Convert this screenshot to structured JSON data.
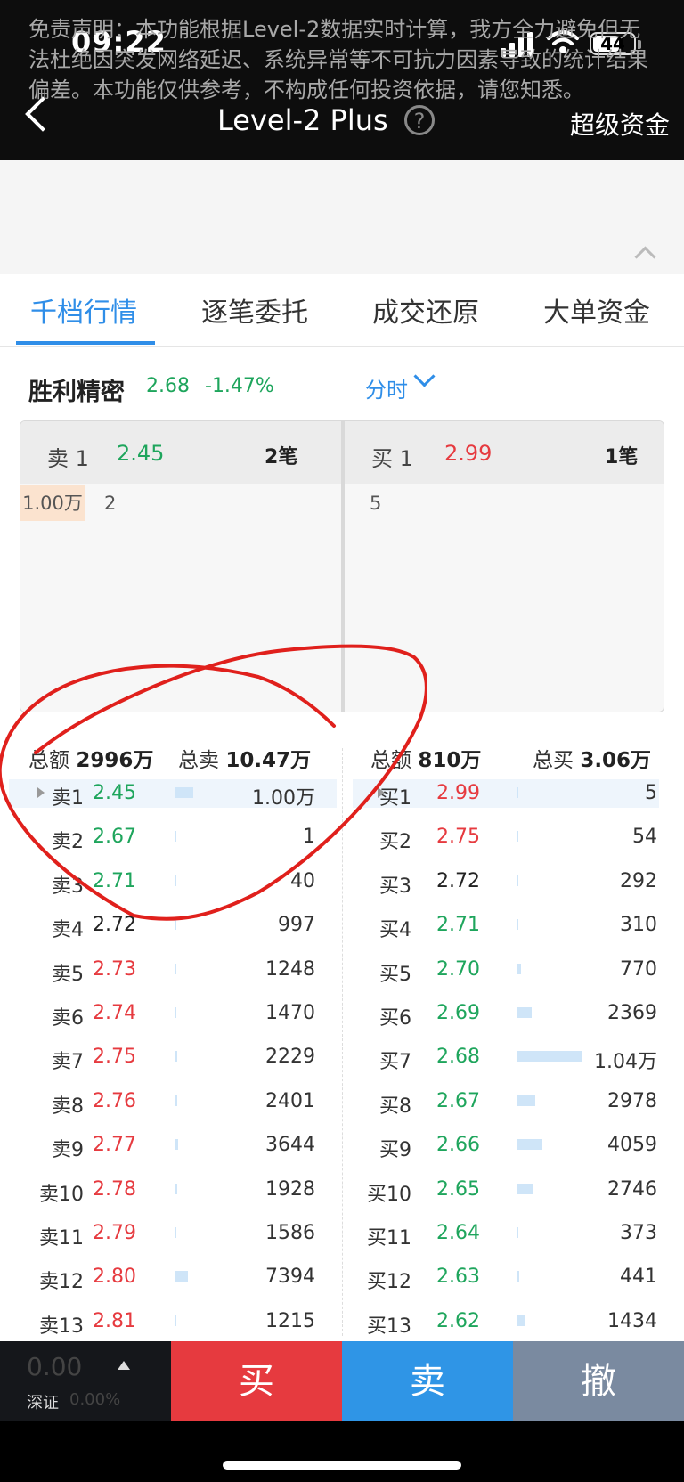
{
  "status_bar": {
    "time": "09:22",
    "battery": "44"
  },
  "nav": {
    "title": "Level-2 Plus",
    "help": "?",
    "right": "超级资金"
  },
  "disclaimer": "免责声明：本功能根据Level-2数据实时计算，我方全力避免但无法杜绝因突发网络延迟、系统异常等不可抗力因素导致的统计结果偏差。本功能仅供参考，不构成任何投资依据，请您知悉。",
  "tabs": [
    "千档行情",
    "逐笔委托",
    "成交还原",
    "大单资金"
  ],
  "stock": {
    "name": "胜利精密",
    "price": "2.68",
    "change": "-1.47%",
    "period": "分时"
  },
  "queue": {
    "sell": {
      "label": "卖 1",
      "price": "2.45",
      "count": "2笔",
      "items": [
        "1.00万",
        "2"
      ]
    },
    "buy": {
      "label": "买 1",
      "price": "2.99",
      "count": "1笔",
      "items": [
        "5"
      ]
    }
  },
  "totals": {
    "sell_amount_label": "总额",
    "sell_amount": "2996万",
    "sell_total_label": "总卖",
    "sell_total": "10.47万",
    "buy_amount_label": "总额",
    "buy_amount": "810万",
    "buy_total_label": "总买",
    "buy_total": "3.06万"
  },
  "colors": {
    "up": "#e63a3f",
    "down": "#1ea55c",
    "flat": "#222222",
    "accent": "#2f8ee8",
    "buy_btn": "#e63a3f",
    "sell_btn": "#2f95e6",
    "cancel_btn": "#7a8aa0"
  },
  "sell_levels": [
    {
      "label": "卖1",
      "price": "2.45",
      "color": "green",
      "vol": "1.00万",
      "bar": 0.28
    },
    {
      "label": "卖2",
      "price": "2.67",
      "color": "green",
      "vol": "1",
      "bar": 0
    },
    {
      "label": "卖3",
      "price": "2.71",
      "color": "green",
      "vol": "40",
      "bar": 0
    },
    {
      "label": "卖4",
      "price": "2.72",
      "color": "dark",
      "vol": "997",
      "bar": 0.02
    },
    {
      "label": "卖5",
      "price": "2.73",
      "color": "red",
      "vol": "1248",
      "bar": 0.03
    },
    {
      "label": "卖6",
      "price": "2.74",
      "color": "red",
      "vol": "1470",
      "bar": 0.03
    },
    {
      "label": "卖7",
      "price": "2.75",
      "color": "red",
      "vol": "2229",
      "bar": 0.04
    },
    {
      "label": "卖8",
      "price": "2.76",
      "color": "red",
      "vol": "2401",
      "bar": 0.04
    },
    {
      "label": "卖9",
      "price": "2.77",
      "color": "red",
      "vol": "3644",
      "bar": 0.05
    },
    {
      "label": "卖10",
      "price": "2.78",
      "color": "red",
      "vol": "1928",
      "bar": 0.04
    },
    {
      "label": "卖11",
      "price": "2.79",
      "color": "red",
      "vol": "1586",
      "bar": 0.03
    },
    {
      "label": "卖12",
      "price": "2.80",
      "color": "red",
      "vol": "7394",
      "bar": 0.2
    },
    {
      "label": "卖13",
      "price": "2.81",
      "color": "red",
      "vol": "1215",
      "bar": 0.03
    }
  ],
  "buy_levels": [
    {
      "label": "买1",
      "price": "2.99",
      "color": "red",
      "vol": "5",
      "bar": 0
    },
    {
      "label": "买2",
      "price": "2.75",
      "color": "red",
      "vol": "54",
      "bar": 0.02
    },
    {
      "label": "买3",
      "price": "2.72",
      "color": "dark",
      "vol": "292",
      "bar": 0.02
    },
    {
      "label": "买4",
      "price": "2.71",
      "color": "green",
      "vol": "310",
      "bar": 0.02
    },
    {
      "label": "买5",
      "price": "2.70",
      "color": "green",
      "vol": "770",
      "bar": 0.07
    },
    {
      "label": "买6",
      "price": "2.69",
      "color": "green",
      "vol": "2369",
      "bar": 0.23
    },
    {
      "label": "买7",
      "price": "2.68",
      "color": "green",
      "vol": "1.04万",
      "bar": 1.0
    },
    {
      "label": "买8",
      "price": "2.67",
      "color": "green",
      "vol": "2978",
      "bar": 0.29
    },
    {
      "label": "买9",
      "price": "2.66",
      "color": "green",
      "vol": "4059",
      "bar": 0.39
    },
    {
      "label": "买10",
      "price": "2.65",
      "color": "green",
      "vol": "2746",
      "bar": 0.26
    },
    {
      "label": "买11",
      "price": "2.64",
      "color": "green",
      "vol": "373",
      "bar": 0.03
    },
    {
      "label": "买12",
      "price": "2.63",
      "color": "green",
      "vol": "441",
      "bar": 0.04
    },
    {
      "label": "买13",
      "price": "2.62",
      "color": "green",
      "vol": "1434",
      "bar": 0.14
    }
  ],
  "bottom": {
    "index_value": "0.00",
    "index_name": "深证",
    "index_pct": "0.00%",
    "buy": "买",
    "sell": "卖",
    "cancel": "撤"
  }
}
